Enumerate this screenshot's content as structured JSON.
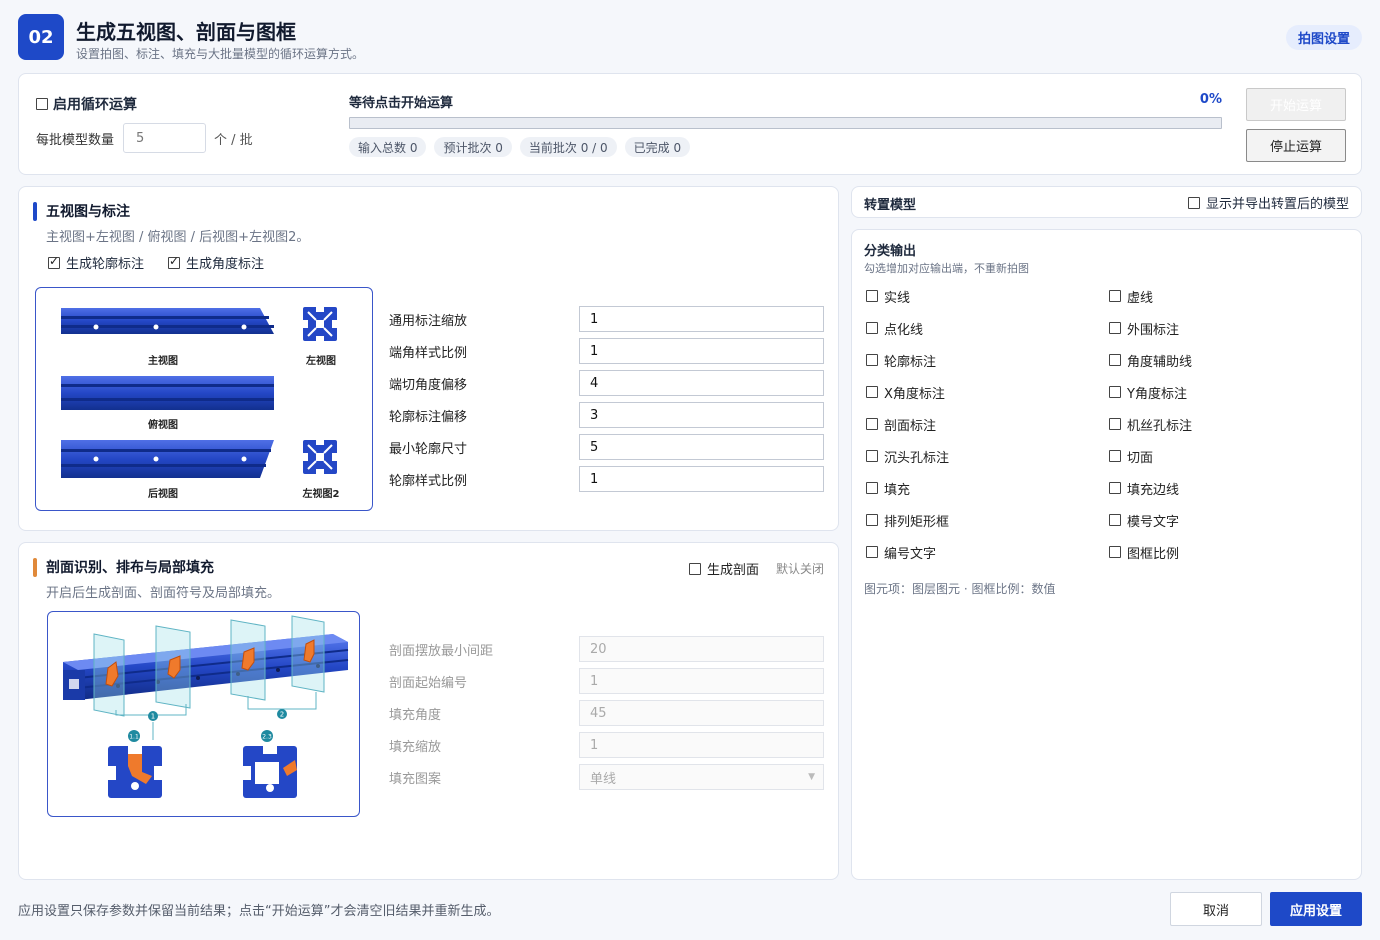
{
  "header": {
    "step": "02",
    "title": "生成五视图、剖面与图框",
    "subtitle": "设置拍图、标注、填充与大批量模型的循环运算方式。",
    "tag": "拍图设置"
  },
  "run": {
    "loop_label": "启用循环运算",
    "loop_checked": false,
    "batch_label": "每批模型数量",
    "batch_value": "5",
    "batch_unit": "个 / 批",
    "status": "等待点击开始运算",
    "percent_label": "0%",
    "progress": 0,
    "pills": [
      "输入总数 0",
      "预计批次 0",
      "当前批次 0 / 0",
      "已完成 0"
    ],
    "start_label": "开始运算",
    "stop_label": "停止运算"
  },
  "views": {
    "title": "五视图与标注",
    "desc": "主视图+左视图 / 俯视图 / 后视图+左视图2。",
    "check_outline": "生成轮廓标注",
    "check_angle": "生成角度标注",
    "captions": {
      "front": "主视图",
      "left": "左视图",
      "top": "俯视图",
      "back": "后视图",
      "left2": "左视图2"
    },
    "params": [
      {
        "label": "通用标注缩放",
        "value": "1"
      },
      {
        "label": "端角样式比例",
        "value": "1"
      },
      {
        "label": "端切角度偏移",
        "value": "4"
      },
      {
        "label": "轮廓标注偏移",
        "value": "3"
      },
      {
        "label": "最小轮廓尺寸",
        "value": "5"
      },
      {
        "label": "轮廓样式比例",
        "value": "1"
      }
    ]
  },
  "section": {
    "title": "剖面识别、排布与局部填充",
    "desc": "开启后生成剖面、剖面符号及局部填充。",
    "gen_label": "生成剖面",
    "gen_hint": "默认关闭",
    "markers": {
      "m1": "1",
      "m2": "2",
      "m11": "1.1",
      "m23": "2.3"
    },
    "params": [
      {
        "label": "剖面摆放最小间距",
        "value": "20"
      },
      {
        "label": "剖面起始编号",
        "value": "1"
      },
      {
        "label": "填充角度",
        "value": "45"
      },
      {
        "label": "填充缩放",
        "value": "1"
      }
    ],
    "pattern_label": "填充图案",
    "pattern_value": "单线"
  },
  "rotate": {
    "title": "转置模型",
    "check_label": "显示并导出转置后的模型"
  },
  "classify": {
    "title": "分类输出",
    "desc": "勾选增加对应输出端，不重新拍图",
    "items": [
      "实线",
      "虚线",
      "点化线",
      "外围标注",
      "轮廓标注",
      "角度辅助线",
      "X角度标注",
      "Y角度标注",
      "剖面标注",
      "机丝孔标注",
      "沉头孔标注",
      "切面",
      "填充",
      "填充边线",
      "排列矩形框",
      "模号文字",
      "编号文字",
      "图框比例"
    ],
    "note": "图元项：图层图元 · 图框比例：数值"
  },
  "footer": {
    "note": "应用设置只保存参数并保留当前结果；点击“开始运算”才会清空旧结果并重新生成。",
    "cancel_label": "取消",
    "apply_label": "应用设置"
  },
  "colors": {
    "accent": "#1e49c8",
    "section_accent": "#e0893a",
    "profile_blue": "#2447c6"
  }
}
